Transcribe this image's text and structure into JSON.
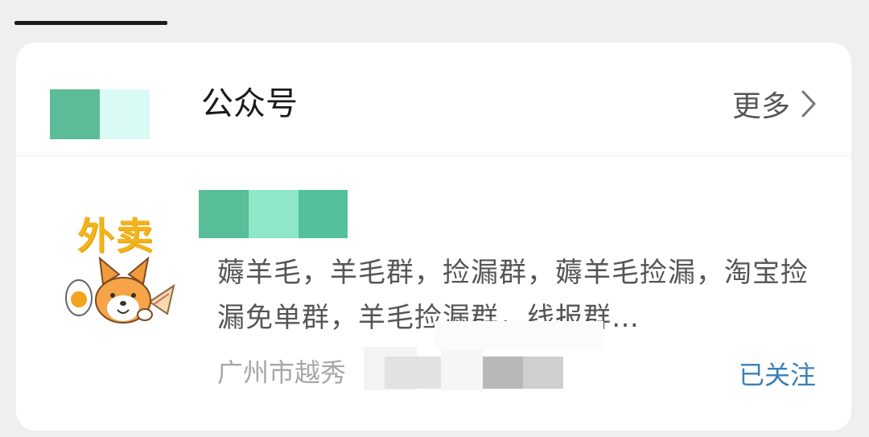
{
  "header": {
    "title": "公众号",
    "more_label": "更多",
    "icon_colors": [
      "#5bbc97",
      "#d9faf5"
    ]
  },
  "account": {
    "avatar_text": "外卖",
    "name_colors": [
      "#57be98",
      "#8ee8c8",
      "#54c19c"
    ],
    "description": "薅羊毛，羊毛群，捡漏群，薅羊毛捡漏，淘宝捡漏免单群，羊毛捡漏群，线报群…",
    "location": "广州市越秀",
    "follow_status": "已关注"
  }
}
